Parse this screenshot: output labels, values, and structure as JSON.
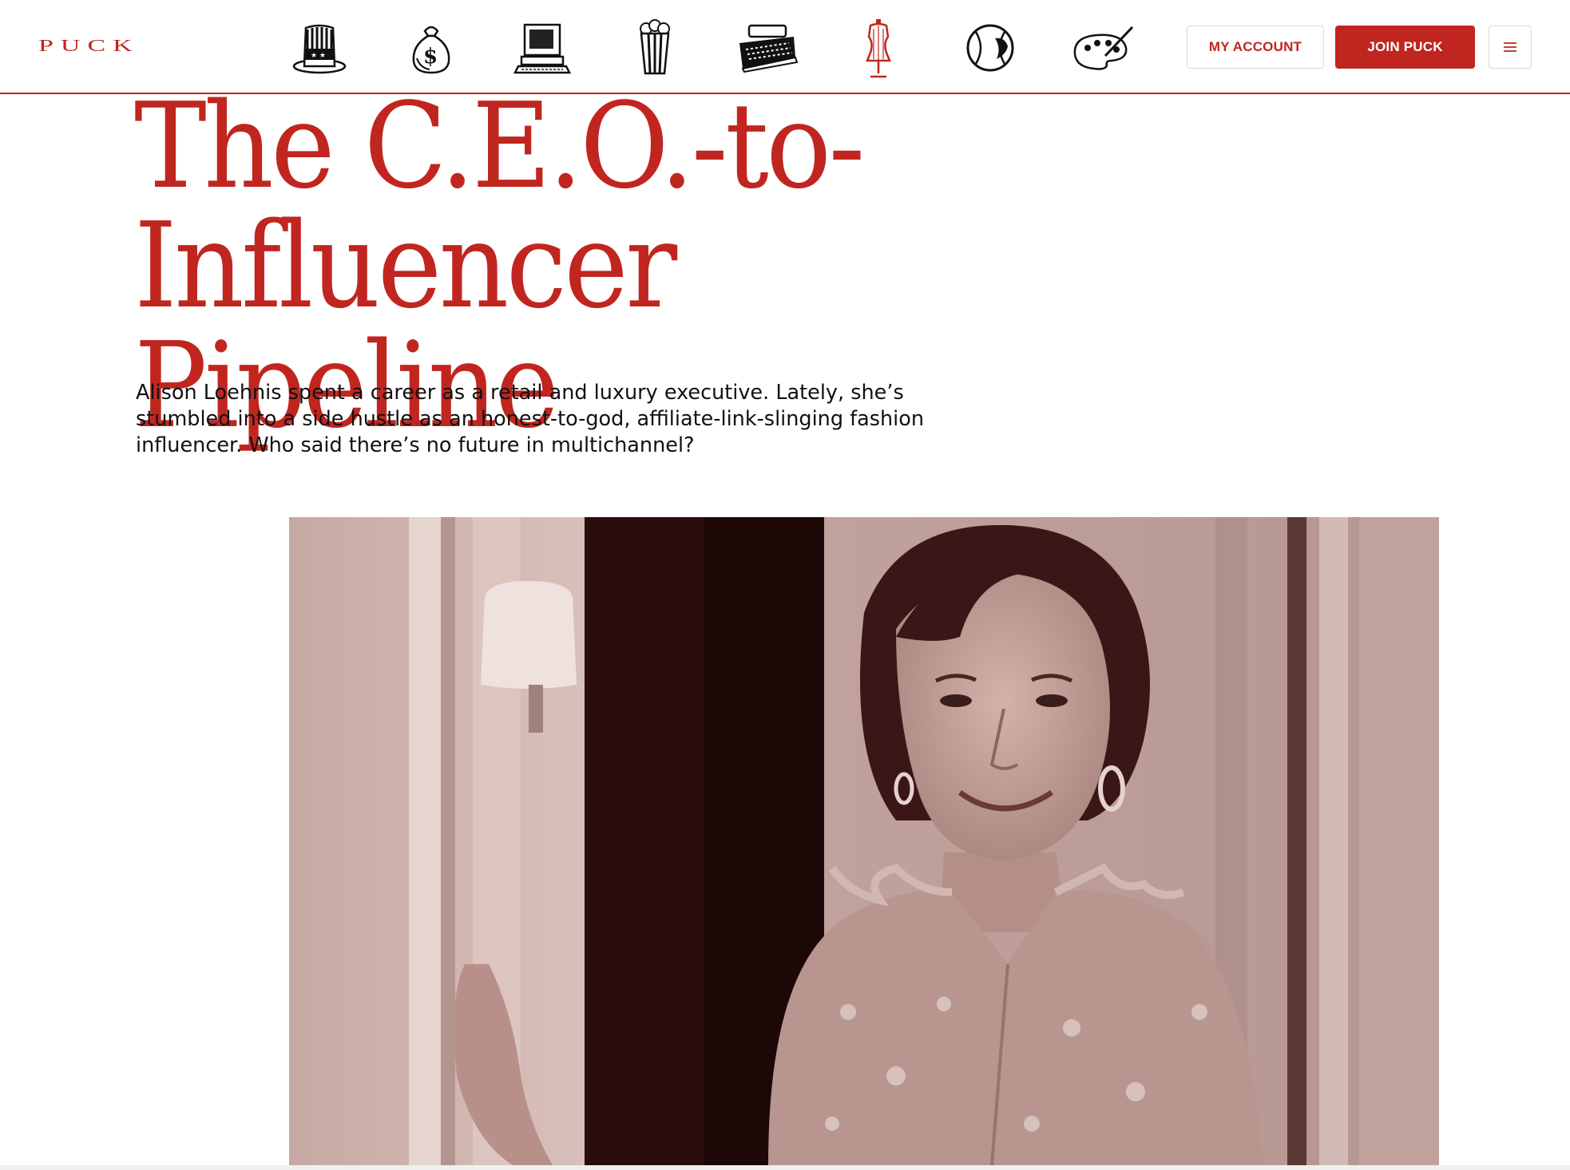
{
  "header": {
    "logo": "PUCK",
    "section_icons": [
      "uncle-sam-hat-icon",
      "money-bag-icon",
      "computer-icon",
      "popcorn-icon",
      "typewriter-icon",
      "dress-form-icon",
      "baseball-icon",
      "paint-palette-icon"
    ],
    "my_account_label": "MY ACCOUNT",
    "join_label": "JOIN PUCK",
    "menu_icon": "hamburger-menu-icon"
  },
  "article": {
    "headline_line1": "The C.E.O.-to-Influencer",
    "headline_line2": "Pipeline",
    "dek": "Alison Loehnis spent a career as a retail and luxury executive. Lately, she’s stumbled into a side hustle as an honest-to-god, affiliate-link-slinging fashion influencer. Who said there’s no future in multichannel?",
    "hero_image": "portrait-photo"
  },
  "colors": {
    "brand_red": "#c0261f",
    "photo_tint": "#b89994"
  }
}
